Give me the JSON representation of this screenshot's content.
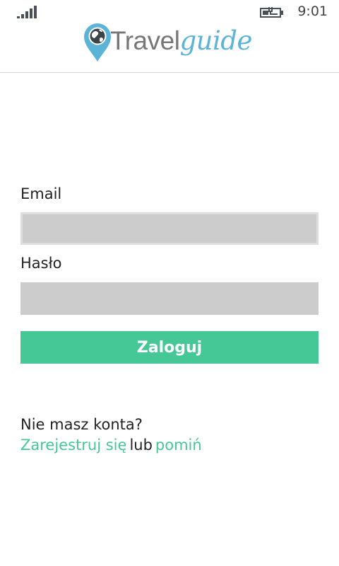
{
  "status_bar": {
    "time": "9:01",
    "signal_icon": "signal-strength-icon",
    "battery_icon": "battery-charging-icon"
  },
  "header": {
    "logo_text_travel": "Travel",
    "logo_text_guide": "guide",
    "logo_icon": "map-pin-globe-icon"
  },
  "form": {
    "email_label": "Email",
    "email_value": "",
    "password_label": "Hasło",
    "password_value": "",
    "login_label": "Zaloguj"
  },
  "footer": {
    "no_account_text": "Nie masz konta?",
    "register_link": "Zarejestruj się",
    "or_text": "lub",
    "skip_link": "pomiń"
  },
  "colors": {
    "accent": "#45c895",
    "logo_blue": "#5cb3d8",
    "input_bg": "#cccccc"
  }
}
